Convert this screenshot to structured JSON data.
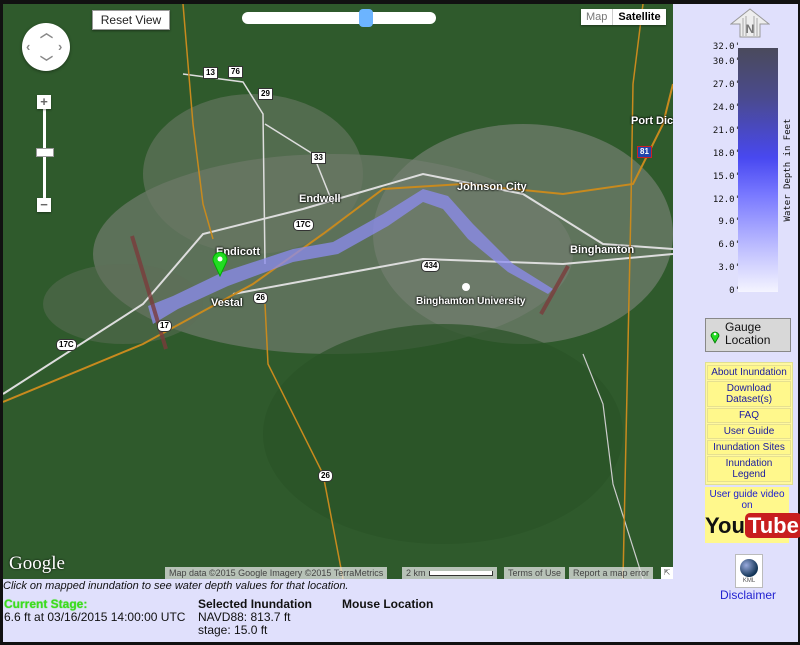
{
  "map": {
    "reset_view_label": "Reset View",
    "opacity_slider_value": 0.65,
    "map_type": {
      "map_label": "Map",
      "satellite_label": "Satellite",
      "selected": "Satellite"
    },
    "zoom_in_label": "+",
    "zoom_out_label": "−",
    "place_labels": {
      "endwell": "Endwell",
      "endicott": "Endicott",
      "vestal": "Vestal",
      "johnson_city": "Johnson City",
      "binghamton": "Binghamton",
      "binghamton_university": "Binghamton University",
      "port_dickinson": "Port Dic"
    },
    "route_shields": {
      "r13": "13",
      "r76": "76",
      "r29": "29",
      "r33": "33",
      "r17c_a": "17C",
      "r17c_b": "17C",
      "r434": "434",
      "r26_a": "26",
      "r26_b": "26",
      "r17": "17",
      "i81": "81"
    },
    "google_logo": "Google",
    "attribution": "Map data ©2015 Google Imagery ©2015 TerraMetrics",
    "scale_label": "2 km",
    "terms_label": "Terms of Use",
    "report_label": "Report a map error"
  },
  "info": {
    "hint": "Click on mapped inundation to see water depth values for that location.",
    "current_stage": {
      "heading": "Current Stage:",
      "value": "6.6 ft at 03/16/2015 14:00:00 UTC"
    },
    "selected_inundation": {
      "heading": "Selected Inundation",
      "navd88": "NAVD88: 813.7 ft",
      "stage": "stage: 15.0 ft"
    },
    "mouse_location": {
      "heading": "Mouse Location"
    }
  },
  "legend": {
    "north_label": "N",
    "title": "Water Depth in Feet",
    "ticks": [
      "32.0'",
      "30.0'",
      "27.0'",
      "24.0'",
      "21.0'",
      "18.0'",
      "15.0'",
      "12.0'",
      "9.0'",
      "6.0'",
      "3.0'",
      "0'"
    ],
    "tick_values": [
      32,
      30,
      27,
      24,
      21,
      18,
      15,
      12,
      9,
      6,
      3,
      0
    ],
    "range_ft": [
      0,
      32
    ]
  },
  "sidebar": {
    "gauge_location": "Gauge Location",
    "links": [
      "About Inundation",
      "Download Dataset(s)",
      "FAQ",
      "User Guide",
      "Inundation Sites",
      "Inundation Legend"
    ],
    "youtube": {
      "text": "User guide video on",
      "you": "You",
      "tube": "Tube"
    },
    "kml_label": "KML",
    "disclaimer": "Disclaimer"
  },
  "colors": {
    "gauge_marker": "#22dd22",
    "current_stage": "#3cdc1e",
    "inundation": "#8c8cf0",
    "panel_bg": "#e0e0fc"
  }
}
